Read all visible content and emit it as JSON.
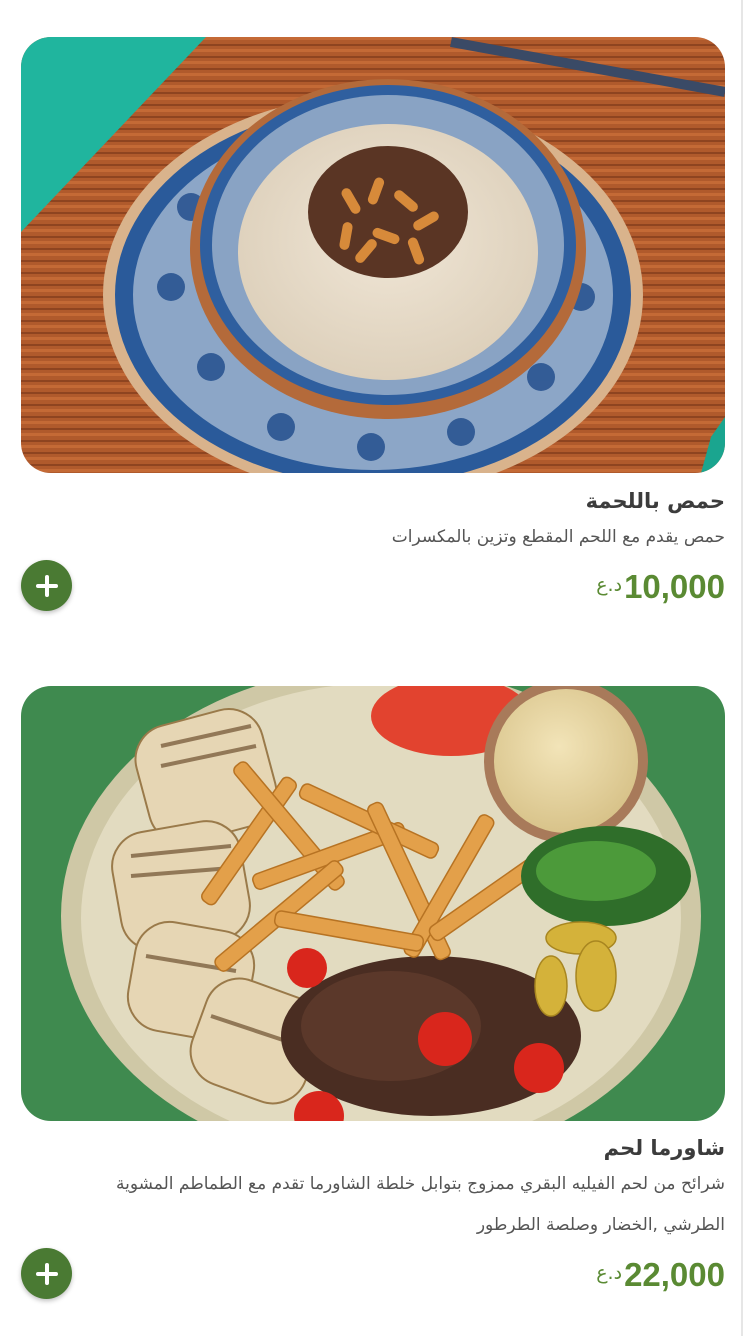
{
  "menu": {
    "items": [
      {
        "title": "حمص باللحمة",
        "description_lines": [
          "حمص يقدم مع اللحم المقطع وتزين بالمكسرات"
        ],
        "price": "10,000",
        "currency": "د.ع",
        "add_icon": "plus-icon",
        "image": "hummus-with-meat-photo"
      },
      {
        "title": "شاورما لحم",
        "description_lines": [
          "شرائح من لحم الفيليه البقري ممزوج بتوابل خلطة الشاورما تقدم مع الطماطم المشوية",
          "الطرشي ,الخضار وصلصة الطرطور"
        ],
        "price": "22,000",
        "currency": "د.ع",
        "add_icon": "plus-icon",
        "image": "meat-shawarma-platter-photo"
      }
    ]
  },
  "colors": {
    "accent": "#4a7a33",
    "price": "#5a8a33",
    "title": "#3c3c3c",
    "description": "#555555"
  }
}
